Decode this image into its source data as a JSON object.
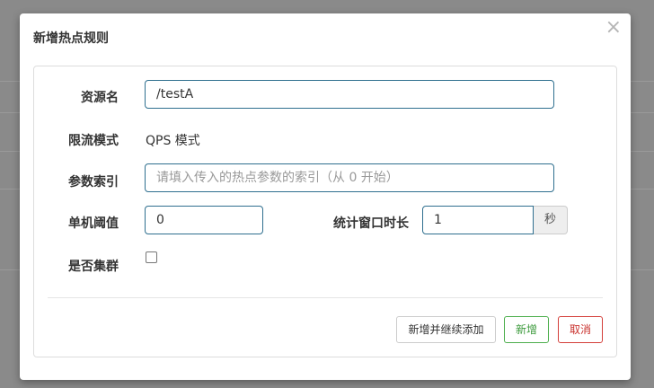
{
  "dialog": {
    "title": "新增热点规则",
    "close_glyph": "×"
  },
  "form": {
    "resource": {
      "label": "资源名",
      "value": "/testA"
    },
    "mode": {
      "label": "限流模式",
      "value": "QPS 模式"
    },
    "param_index": {
      "label": "参数索引",
      "value": "",
      "placeholder": "请填入传入的热点参数的索引（从 0 开始）"
    },
    "threshold": {
      "label": "单机阈值",
      "value": "0"
    },
    "window": {
      "label": "统计窗口时长",
      "value": "1",
      "unit": "秒"
    },
    "cluster": {
      "label": "是否集群",
      "checked": false
    }
  },
  "buttons": {
    "add_continue": "新增并继续添加",
    "add": "新增",
    "cancel": "取消"
  }
}
